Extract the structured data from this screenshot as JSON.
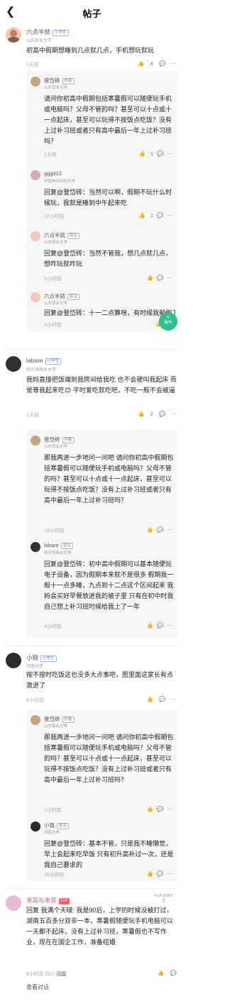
{
  "header": {
    "back_icon": "chevron-left-icon",
    "title": "帖子"
  },
  "c1": {
    "user": "六点半就",
    "badge": "小学生",
    "school": "山东农业大学",
    "text": "初高中假期想睡到几点就几点，手机想玩就玩",
    "time": "1天前",
    "likes": "4",
    "replies": [
      {
        "user": "登岱砖",
        "tag": "作者",
        "school": "山东农业大学",
        "text": "请问你初高中假期包括寒暑假可以随便玩手机或电脑吗？父母不管的吗？甚至可以十点或十一点起床，甚至可以玩得不按饭点吃饭？没有上过补习班或者只有高中最后一年上过补习班吗？",
        "time": "1天前",
        "likes": "1"
      },
      {
        "user": "ggg312",
        "tag": "",
        "school": "中南林业科技大学",
        "text": "回复@登岱砖：当然可以啊，假期不玩什么时候玩，我就是睡到中午起来吃",
        "time": "10小时前",
        "likes": "1"
      },
      {
        "user": "六点半就",
        "tag": "层主",
        "school": "山东农业大学",
        "text": "回复@登岱砖：当然不管我，想几点就几点，想咋玩就咋玩",
        "time": "5小时前",
        "likes": ""
      },
      {
        "user": "六点半就",
        "tag": "层主",
        "school": "山东农业大学",
        "text": "回复@登岱砖：十一二点算啥，有时候我躺倒下午，你说的这些我都符合",
        "time": "5小时前",
        "likes": ""
      }
    ]
  },
  "fab": {
    "label": "操作"
  },
  "c2": {
    "user": "labare",
    "badge": "小学生",
    "school": "哈尔滨商业大学",
    "text": "我妈直接把饭端到我房间给我吃 也不会硬叫我起床 而是等我起来吃😊 平时爱吃就吃吧，不吃一般不会被逼",
    "time": "1天前",
    "likes": "2",
    "replies": [
      {
        "user": "登岱砖",
        "tag": "作者",
        "school": "山东农业大学",
        "text": "那我再进一步地问一问吧 请问你初高中假期包括寒暑假可以随便玩手机或电脑吗？父母不管的吗？甚至可以十点或十一点起床，甚至可以玩得不按饭点吃饭？没有上过补习班或者只有高中最后一年上过补习班吗？",
        "time": "18小时前",
        "likes": ""
      },
      {
        "user": "labare",
        "tag": "层主",
        "school": "哈尔滨商业大学",
        "text": "回复@登岱砖：初中高中假期可以基本随便玩电子设备，因为假期本来就不是很多 假期我一般十一点多睡，九点到十二点这个区间起来 我妈会买好早餐放进我的被子里 只有在初中时我自己想上补习班时候给我上了一年",
        "time": "4小时前",
        "likes": ""
      }
    ]
  },
  "c3": {
    "user": "小锦",
    "badge": "小学生",
    "school": "河南大学",
    "text": "按不按时吃饭这也没多大点事吧，图里面这家长有点激进了",
    "time": "8小时前",
    "likes": "",
    "replies": [
      {
        "user": "登岱砖",
        "tag": "作者",
        "school": "山东农业大学",
        "text": "那我再进一步地问一问吧 请问你初高中假期包括寒暑假可以随便玩手机或电脑吗？父母不管的吗？甚至可以十点或十一点起床，甚至可以玩得不按饭点吃饭？没有上过补习班或者只有高中最后一年上过补习班吗？",
        "time": "1小时前",
        "likes": ""
      },
      {
        "user": "小锦",
        "tag": "层主",
        "school": "河南大学",
        "text": "回复@登岱砖：基本不管，只是我不睡懒觉，早上会起来吃早饭 只有初升高补过一次，还是我自己要求的",
        "time": "26分钟前",
        "likes": ""
      }
    ]
  },
  "c4": {
    "user": "来其与来音",
    "badge": "LV6",
    "text": "回复 我满个天啵: 我是90后，上学的时候没被打过，湖南五百多分双非一本，寒暑假随便玩手机电脑可以一天都不起床，没有上过补习班，寒暑假也不写作业，现在在国企工作，准备结婚",
    "time": "4小时前",
    "location": "四川",
    "reply_label": "回复",
    "watermark": "NGA 玩家社区"
  },
  "bottom": {
    "view_replies": "查看对话"
  }
}
